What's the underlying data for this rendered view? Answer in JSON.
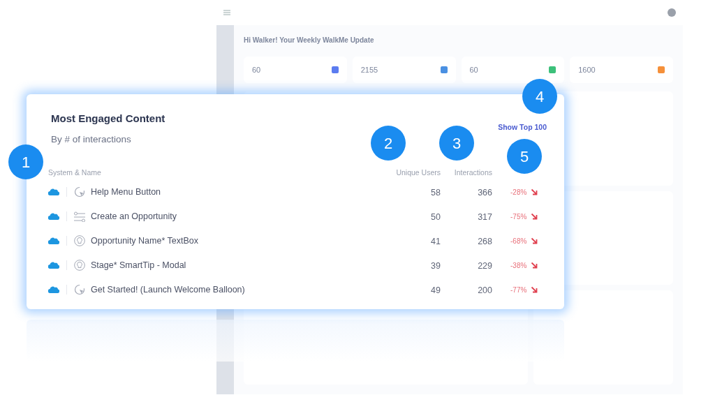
{
  "dashboard": {
    "greeting": "Hi Walker! Your Weekly WalkMe Update",
    "stats": [
      {
        "value": "60",
        "color": "#5b7cf0"
      },
      {
        "value": "2155",
        "color": "#4a90e2"
      },
      {
        "value": "60",
        "color": "#3cc07a"
      },
      {
        "value": "1600",
        "color": "#f5903a"
      }
    ]
  },
  "card": {
    "title": "Most Engaged Content",
    "subtitle": "By # of interactions",
    "link": "Show Top 100",
    "columns": [
      "System & Name",
      "Unique Users",
      "Interactions"
    ],
    "rows": [
      {
        "kind": "launcher",
        "name": "Help Menu Button",
        "users": "58",
        "interactions": "366",
        "change": "-28%",
        "declining": true
      },
      {
        "kind": "walkthru",
        "name": "Create an Opportunity",
        "users": "50",
        "interactions": "317",
        "change": "-75%",
        "declining": true
      },
      {
        "kind": "smarttip",
        "name": "Opportunity Name* TextBox",
        "users": "41",
        "interactions": "268",
        "change": "-68%",
        "declining": true
      },
      {
        "kind": "smarttip",
        "name": "Stage* SmartTip - Modal",
        "users": "39",
        "interactions": "229",
        "change": "-38%",
        "declining": true
      },
      {
        "kind": "launcher",
        "name": "Get Started! (Launch Welcome Balloon)",
        "users": "49",
        "interactions": "200",
        "change": "-77%",
        "declining": true
      }
    ]
  },
  "callouts": [
    "1",
    "2",
    "3",
    "4",
    "5"
  ]
}
